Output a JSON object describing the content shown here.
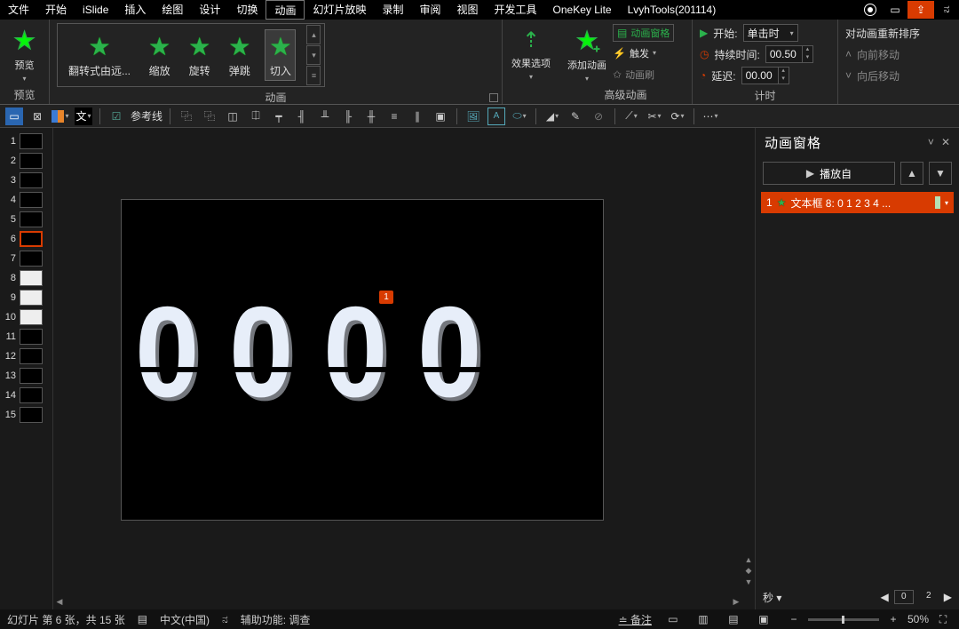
{
  "menu": {
    "items": [
      "文件",
      "开始",
      "iSlide",
      "插入",
      "绘图",
      "设计",
      "切换",
      "动画",
      "幻灯片放映",
      "录制",
      "审阅",
      "视图",
      "开发工具",
      "OneKey Lite",
      "LvyhTools(201114)"
    ],
    "active_index": 7
  },
  "ribbon": {
    "preview": {
      "label": "预览",
      "group": "预览"
    },
    "gallery": {
      "items": [
        "翻转式由远...",
        "缩放",
        "旋转",
        "弹跳",
        "切入"
      ],
      "current_index": 4,
      "group": "动画"
    },
    "effect_options": "效果选项",
    "advanced": {
      "add_anim": "添加动画",
      "pane": "动画窗格",
      "trigger": "触发",
      "painter": "动画刷",
      "group": "高级动画"
    },
    "timing": {
      "start_label": "开始:",
      "start_value": "单击时",
      "duration_label": "持续时间:",
      "duration_value": "00.50",
      "delay_label": "延迟:",
      "delay_value": "00.00",
      "group": "计时"
    },
    "reorder": {
      "title": "对动画重新排序",
      "earlier": "向前移动",
      "later": "向后移动"
    }
  },
  "toolbar2": {
    "guides": "参考线"
  },
  "thumbs": {
    "count": 15,
    "selected": 6
  },
  "slide": {
    "anim_tag": "1"
  },
  "anim_pane": {
    "title": "动画窗格",
    "play": "播放自",
    "item_num": "1",
    "item_text": "文本框 8: 0 1 2 3 4 ...",
    "sec_label": "秒",
    "n0": "0",
    "n2": "2"
  },
  "status": {
    "slide_info": "幻灯片 第 6 张，共 15 张",
    "lang": "中文(中国)",
    "access": "辅助功能: 调查",
    "notes": "备注",
    "zoom": "50%"
  }
}
